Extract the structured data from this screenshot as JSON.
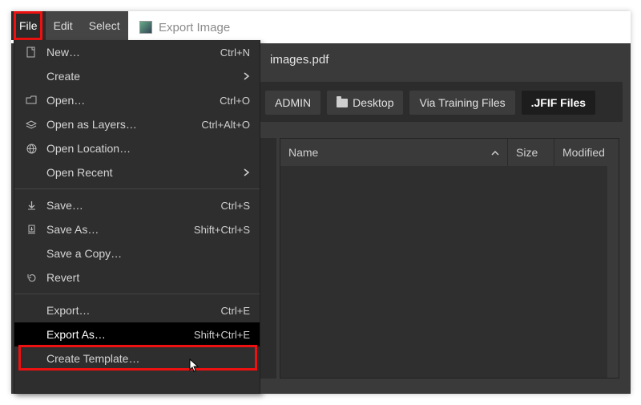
{
  "menubar": {
    "items": [
      "File",
      "Edit",
      "Select"
    ],
    "activeIndex": 0
  },
  "systitle": "Export Image",
  "file_menu": {
    "groups": [
      [
        {
          "icon": "new",
          "label": "New…",
          "accel": "Ctrl+N"
        },
        {
          "icon": "",
          "label": "Create",
          "accel": "",
          "submenu": true
        },
        {
          "icon": "open",
          "label": "Open…",
          "accel": "Ctrl+O"
        },
        {
          "icon": "layers",
          "label": "Open as Layers…",
          "accel": "Ctrl+Alt+O"
        },
        {
          "icon": "globe",
          "label": "Open Location…",
          "accel": ""
        },
        {
          "icon": "",
          "label": "Open Recent",
          "accel": "",
          "submenu": true
        }
      ],
      [
        {
          "icon": "save",
          "label": "Save…",
          "accel": "Ctrl+S"
        },
        {
          "icon": "saveas",
          "label": "Save As…",
          "accel": "Shift+Ctrl+S"
        },
        {
          "icon": "",
          "label": "Save a Copy…",
          "accel": ""
        },
        {
          "icon": "revert",
          "label": "Revert",
          "accel": ""
        }
      ],
      [
        {
          "icon": "",
          "label": "Export…",
          "accel": "Ctrl+E"
        },
        {
          "icon": "",
          "label": "Export As…",
          "accel": "Shift+Ctrl+E",
          "highlight": true
        },
        {
          "icon": "",
          "label": "Create Template…",
          "accel": ""
        }
      ]
    ]
  },
  "dialog": {
    "filename": "images.pdf",
    "breadcrumbs": [
      {
        "label": "ADMIN",
        "icon": false
      },
      {
        "label": "Desktop",
        "icon": true
      },
      {
        "label": "Via Training Files",
        "icon": false
      },
      {
        "label": ".JFIF Files",
        "icon": false,
        "active": true
      }
    ],
    "columns": {
      "name": "Name",
      "size": "Size",
      "modified": "Modified"
    }
  }
}
